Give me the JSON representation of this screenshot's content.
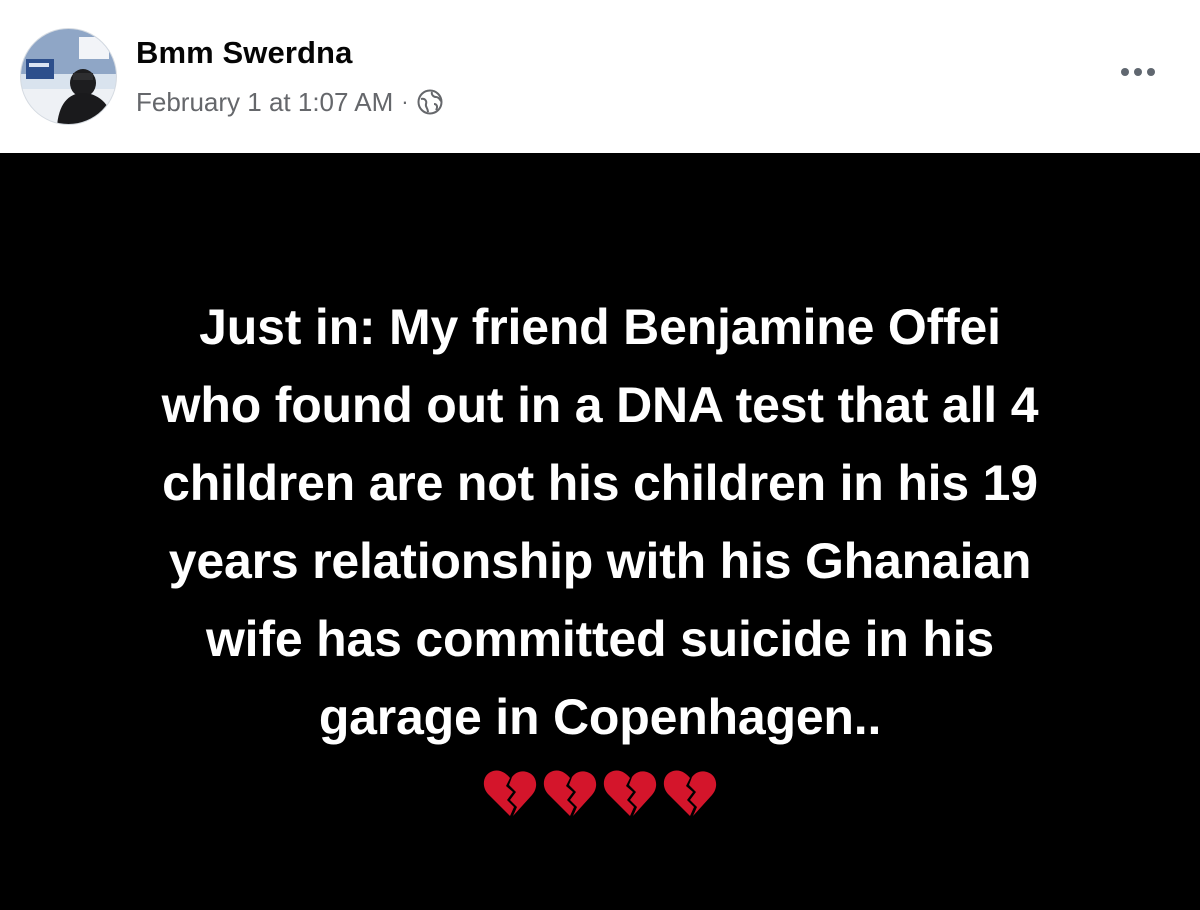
{
  "post": {
    "author_name": "Bmm Swerdna",
    "timestamp": "February 1 at 1:07 AM",
    "separator": "·",
    "privacy_icon": "globe-icon",
    "more_icon": "more-options-icon",
    "text_lines": [
      "Just in: My friend Benjamine Offei",
      "who found out in a DNA test that all 4",
      "children are not his children in his 19",
      "years relationship with his Ghanaian",
      "wife has committed suicide in his",
      "garage in Copenhagen.."
    ],
    "emojis": [
      "💔",
      "💔",
      "💔",
      "💔"
    ],
    "colors": {
      "background": "#000000",
      "text": "#ffffff",
      "meta": "#65676b",
      "heart": "#d4152b"
    }
  }
}
